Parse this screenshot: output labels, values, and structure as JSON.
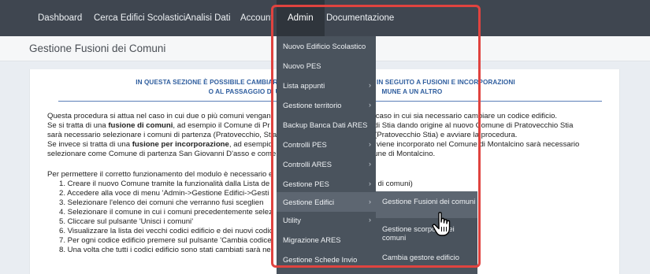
{
  "nav": {
    "items": [
      "Dashboard",
      "Cerca Edifici Scolastici",
      "Analisi Dati",
      "Account",
      "Admin",
      "Documentazione"
    ],
    "active": "Admin"
  },
  "page": {
    "title": "Gestione Fusioni dei Comuni"
  },
  "content": {
    "intro_line1_a": "IN QUESTA SEZIONE È POSSIBILE CAMBIARE",
    "intro_line1_b": "IN SEGUITO A FUSIONI E INCORPORAZIONI",
    "intro_line2_a": "O AL PASSAGGIO DI UN",
    "intro_line2_b": "MUNE A UN ALTRO",
    "p1_a": "Questa procedura si attua nel caso in cui due o più comuni vengan",
    "p1_b": "caso in cui sia necessario cambiare un codice edificio.",
    "p2_a": "Se si tratta di una ",
    "p2_bold": "fusione di comuni",
    "p2_b": ", ad esempio il Comune di Pr",
    "p2_c": "e di Stia dando origine al nuovo Comune di Pratovecchio Stia",
    "p3_a": "sarà necessario selezionare i comuni di partenza (Pratovecchio, Stia",
    "p3_b": "(Pratovecchio Stia) e avviare la procedura.",
    "p4_a": "Se invece si tratta di una ",
    "p4_bold": "fusione per incorporazione",
    "p4_b": ", ad esempio",
    "p4_c": "o viene incorporato nel Comune di Montalcino sarà necessario",
    "p5_a": "selezionare come Comune di partenza San Giovanni D'asso e come",
    "p5_b": "une di Montalcino.",
    "p6": "Per permettere il corretto funzionamento del modulo è necessario e",
    "step1_a": "1. Creare il nuovo Comune tramite la funzionalità dalla ",
    "step1_link": "Lista de",
    "step1_b": "ne di comuni)",
    "step2": "2. Accedere alla voce di menu 'Admin->Gestione Edifici->Gesti",
    "step3": "3. Selezionare l'elenco dei comuni che verranno fusi sceglien",
    "step4": "4. Selezionare il comune in cui i comuni precedentemente selez",
    "step5": "5. Cliccare sul pulsante 'Unisci i comuni'",
    "step6_a": "6. Visualizzare la lista dei vecchi codici edificio e dei nuovi codic",
    "step6_b": "e",
    "step7": "7. Per ogni codice edificio premere sul pulsante 'Cambia codice",
    "step8": "8. Una volta che tutti i codici edificio sono stati cambiati sarà ne"
  },
  "admin_menu": {
    "items": [
      {
        "label": "Nuovo Edificio Scolastico",
        "submenu": false
      },
      {
        "label": "Nuovo PES",
        "submenu": false
      },
      {
        "label": "Lista appunti",
        "submenu": true
      },
      {
        "label": "Gestione territorio",
        "submenu": true
      },
      {
        "label": "Backup Banca Dati ARES",
        "submenu": false
      },
      {
        "label": "Controlli PES",
        "submenu": true
      },
      {
        "label": "Controlli ARES",
        "submenu": true
      },
      {
        "label": "Gestione PES",
        "submenu": true
      },
      {
        "label": "Gestione Edifici",
        "submenu": true
      },
      {
        "label": "Utility",
        "submenu": true
      },
      {
        "label": "Migrazione ARES",
        "submenu": false
      },
      {
        "label": "Gestione Schede Invio",
        "submenu": false
      }
    ],
    "active_index": 8,
    "chevron": "›"
  },
  "edifici_submenu": {
    "items": [
      "Gestione Fusioni dei comuni",
      "Gestione scorporo dei comuni",
      "Cambia gestore edificio"
    ]
  },
  "colors": {
    "navbar": "#3f4650",
    "dropdown": "#4a535d",
    "highlight": "#e0433f",
    "intro_text": "#2e5d9e"
  },
  "icons": {
    "cursor": "hand-pointer-icon"
  }
}
